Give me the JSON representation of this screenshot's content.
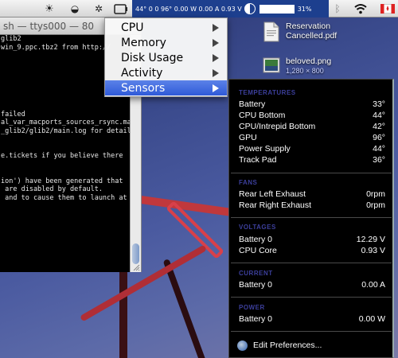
{
  "menubar": {
    "stats_text": "44° 0 0 96° 0.00 W 0.00 A 0.93 V",
    "percent": "31%"
  },
  "terminal": {
    "title": "sh — ttys000 — 80",
    "lines": [
      "glib2",
      "win_9.ppc.tbz2 from http://",
      "",
      "",
      "",
      "",
      "",
      "",
      "",
      "failed",
      "al_var_macports_sources_rsync.ma",
      "_glib2/glib2/main.log for detail",
      "",
      "",
      "e.tickets if you believe there",
      "",
      "",
      "ion') have been generated that",
      " are disabled by default.",
      " and to cause them to launch at"
    ]
  },
  "desktop_icons": [
    {
      "name": "Reservation Cancelled.pdf",
      "line1": "Reservation",
      "line2": "Cancelled.pdf"
    },
    {
      "name": "beloved.png",
      "line1": "beloved.png",
      "line2": "1,280 × 800"
    }
  ],
  "menu": {
    "items": [
      {
        "label": "CPU"
      },
      {
        "label": "Memory"
      },
      {
        "label": "Disk Usage"
      },
      {
        "label": "Activity"
      },
      {
        "label": "Sensors"
      }
    ],
    "selected": "Sensors"
  },
  "sensors": {
    "temperatures": {
      "title": "TEMPERATURES",
      "rows": [
        {
          "label": "Battery",
          "value": "33°"
        },
        {
          "label": "CPU Bottom",
          "value": "44°"
        },
        {
          "label": "CPU/Intrepid Bottom",
          "value": "42°"
        },
        {
          "label": "GPU",
          "value": "96°"
        },
        {
          "label": "Power Supply",
          "value": "44°"
        },
        {
          "label": "Track Pad",
          "value": "36°"
        }
      ]
    },
    "fans": {
      "title": "FANS",
      "rows": [
        {
          "label": "Rear Left Exhaust",
          "value": "0rpm"
        },
        {
          "label": "Rear Right Exhaust",
          "value": "0rpm"
        }
      ]
    },
    "voltages": {
      "title": "VOLTAGES",
      "rows": [
        {
          "label": "Battery 0",
          "value": "12.29 V"
        },
        {
          "label": "CPU Core",
          "value": "0.93 V"
        }
      ]
    },
    "current": {
      "title": "CURRENT",
      "rows": [
        {
          "label": "Battery 0",
          "value": "0.00 A"
        }
      ]
    },
    "power": {
      "title": "POWER",
      "rows": [
        {
          "label": "Battery 0",
          "value": "0.00 W"
        }
      ]
    },
    "edit_label": "Edit Preferences..."
  },
  "colors": {
    "menubar_strip": "#1d3f8e",
    "selection": "#3a64dc",
    "section_title": "#3c3f9c"
  }
}
